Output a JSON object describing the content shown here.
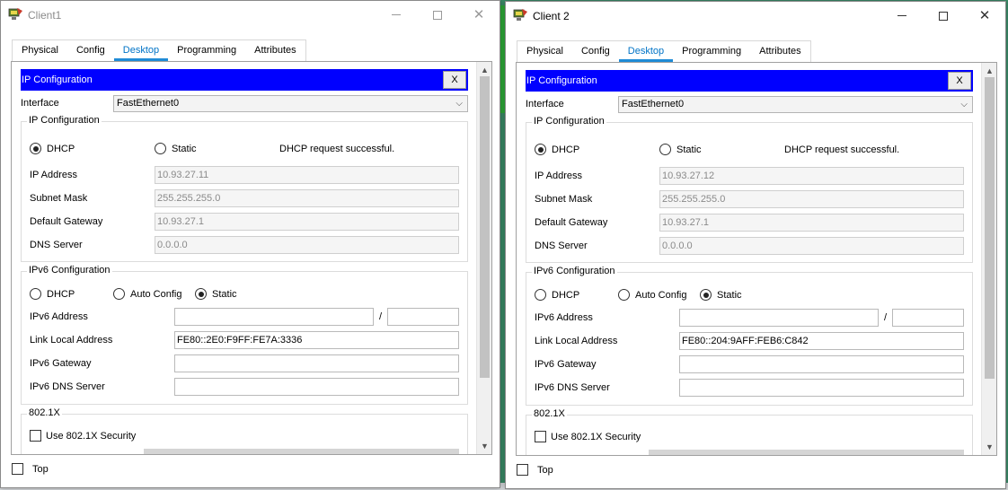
{
  "windows": [
    {
      "title": "Client1",
      "tabs": [
        "Physical",
        "Config",
        "Desktop",
        "Programming",
        "Attributes"
      ],
      "active_tab": "Desktop",
      "ip_config": {
        "header": "IP Configuration",
        "close_label": "X",
        "interface_label": "Interface",
        "interface_value": "FastEthernet0",
        "ipv4_group_title": "IP Configuration",
        "dhcp_label": "DHCP",
        "static_label": "Static",
        "mode": "DHCP",
        "status": "DHCP request successful.",
        "ip_label": "IP Address",
        "ip": "10.93.27.11",
        "mask_label": "Subnet Mask",
        "mask": "255.255.255.0",
        "gw_label": "Default Gateway",
        "gw": "10.93.27.1",
        "dns_label": "DNS Server",
        "dns": "0.0.0.0",
        "ipv6_group_title": "IPv6 Configuration",
        "ipv6_dhcp_label": "DHCP",
        "ipv6_auto_label": "Auto Config",
        "ipv6_static_label": "Static",
        "ipv6_mode": "Static",
        "ipv6_addr_label": "IPv6 Address",
        "ipv6_addr": "",
        "ipv6_prefix": "",
        "slash": "/",
        "link_local_label": "Link Local Address",
        "link_local": "FE80::2E0:F9FF:FE7A:3336",
        "ipv6_gw_label": "IPv6 Gateway",
        "ipv6_gw": "",
        "ipv6_dns_label": "IPv6 DNS Server",
        "ipv6_dns": "",
        "dot1x_title": "802.1X",
        "dot1x_check_label": "Use 802.1X Security"
      },
      "top_label": "Top"
    },
    {
      "title": "Client 2",
      "tabs": [
        "Physical",
        "Config",
        "Desktop",
        "Programming",
        "Attributes"
      ],
      "active_tab": "Desktop",
      "ip_config": {
        "header": "IP Configuration",
        "close_label": "X",
        "interface_label": "Interface",
        "interface_value": "FastEthernet0",
        "ipv4_group_title": "IP Configuration",
        "dhcp_label": "DHCP",
        "static_label": "Static",
        "mode": "DHCP",
        "status": "DHCP request successful.",
        "ip_label": "IP Address",
        "ip": "10.93.27.12",
        "mask_label": "Subnet Mask",
        "mask": "255.255.255.0",
        "gw_label": "Default Gateway",
        "gw": "10.93.27.1",
        "dns_label": "DNS Server",
        "dns": "0.0.0.0",
        "ipv6_group_title": "IPv6 Configuration",
        "ipv6_dhcp_label": "DHCP",
        "ipv6_auto_label": "Auto Config",
        "ipv6_static_label": "Static",
        "ipv6_mode": "Static",
        "ipv6_addr_label": "IPv6 Address",
        "ipv6_addr": "",
        "ipv6_prefix": "",
        "slash": "/",
        "link_local_label": "Link Local Address",
        "link_local": "FE80::204:9AFF:FEB6:C842",
        "ipv6_gw_label": "IPv6 Gateway",
        "ipv6_gw": "",
        "ipv6_dns_label": "IPv6 DNS Server",
        "ipv6_dns": "",
        "dot1x_title": "802.1X",
        "dot1x_check_label": "Use 802.1X Security"
      },
      "top_label": "Top"
    }
  ],
  "colors": {
    "header_blue": "#0000ff",
    "active_tab": "#0073c6"
  },
  "icons": {
    "app": "packet-tracer-pc-icon",
    "dropdown": "chevron-down-icon"
  }
}
